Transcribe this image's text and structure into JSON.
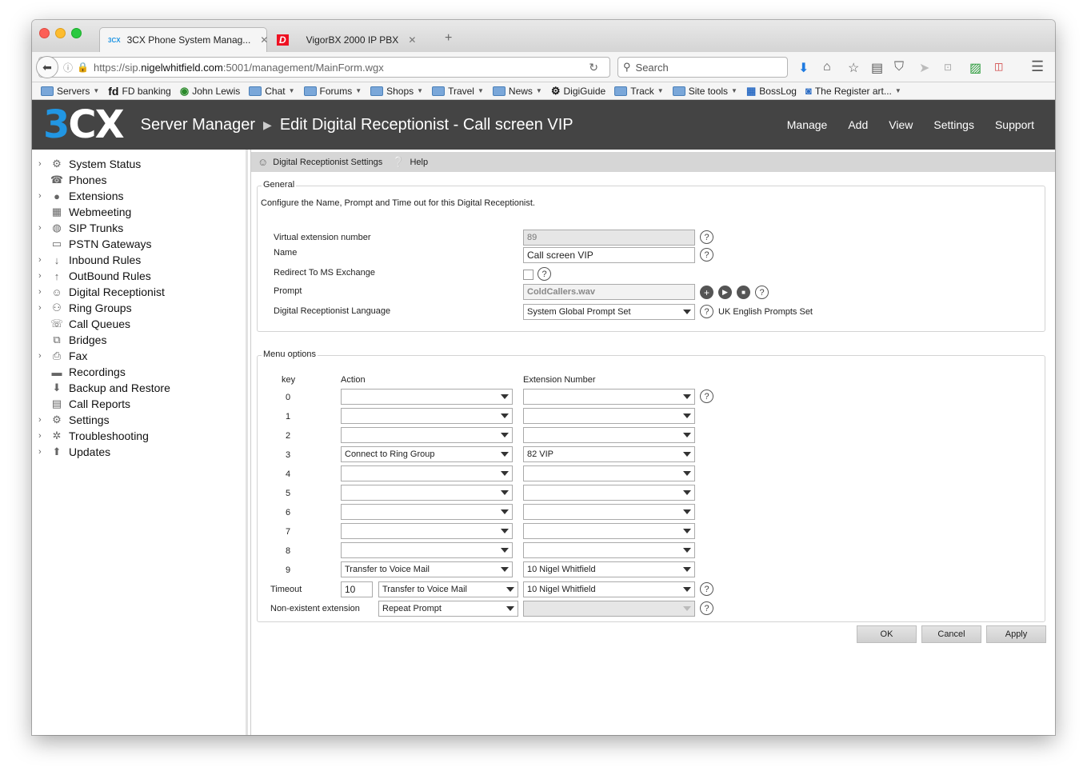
{
  "browser": {
    "tabs": [
      {
        "favicon": "3CX",
        "title": "3CX Phone System Manag...",
        "active": true
      },
      {
        "favicon": "D",
        "title": "VigorBX 2000 IP PBX",
        "active": false
      }
    ],
    "url": {
      "prefix": "https://sip.",
      "domain": "nigelwhitfield.com",
      "suffix": ":5001/management/MainForm.wgx"
    },
    "search_placeholder": "Search",
    "bookmarks": [
      {
        "label": "Servers",
        "icon": "folder-icon",
        "dropdown": true
      },
      {
        "label": "FD banking",
        "icon": "fd-icon",
        "dropdown": false
      },
      {
        "label": "John Lewis",
        "icon": "globe-icon",
        "dropdown": false
      },
      {
        "label": "Chat",
        "icon": "folder-icon",
        "dropdown": true
      },
      {
        "label": "Forums",
        "icon": "folder-icon",
        "dropdown": true
      },
      {
        "label": "Shops",
        "icon": "folder-icon",
        "dropdown": true
      },
      {
        "label": "Travel",
        "icon": "folder-icon",
        "dropdown": true
      },
      {
        "label": "News",
        "icon": "folder-icon",
        "dropdown": true
      },
      {
        "label": "DigiGuide",
        "icon": "gear-icon",
        "dropdown": false
      },
      {
        "label": "Track",
        "icon": "folder-icon",
        "dropdown": true
      },
      {
        "label": "Site tools",
        "icon": "folder-icon",
        "dropdown": true
      },
      {
        "label": "BossLog",
        "icon": "calendar-icon",
        "dropdown": false
      },
      {
        "label": "The Register art...",
        "icon": "rss-icon",
        "dropdown": true
      }
    ]
  },
  "app": {
    "logo_3": "3",
    "logo_cx": "CX",
    "title": "Server Manager",
    "page": "Edit Digital Receptionist - Call screen VIP",
    "menu": [
      "Manage",
      "Add",
      "View",
      "Settings",
      "Support"
    ]
  },
  "sidebar": [
    {
      "label": "System Status",
      "expand": true,
      "icon": "status-icon"
    },
    {
      "label": "Phones",
      "expand": false,
      "icon": "phone-icon"
    },
    {
      "label": "Extensions",
      "expand": true,
      "icon": "user-icon"
    },
    {
      "label": "Webmeeting",
      "expand": false,
      "icon": "webmeeting-icon"
    },
    {
      "label": "SIP Trunks",
      "expand": true,
      "icon": "globe-icon"
    },
    {
      "label": "PSTN Gateways",
      "expand": false,
      "icon": "gateway-icon"
    },
    {
      "label": "Inbound Rules",
      "expand": true,
      "icon": "arrow-down-icon"
    },
    {
      "label": "OutBound Rules",
      "expand": true,
      "icon": "arrow-up-icon"
    },
    {
      "label": "Digital Receptionist",
      "expand": true,
      "icon": "receptionist-icon"
    },
    {
      "label": "Ring Groups",
      "expand": true,
      "icon": "group-icon"
    },
    {
      "label": "Call Queues",
      "expand": false,
      "icon": "queue-icon"
    },
    {
      "label": "Bridges",
      "expand": false,
      "icon": "bridge-icon"
    },
    {
      "label": "Fax",
      "expand": true,
      "icon": "fax-icon"
    },
    {
      "label": "Recordings",
      "expand": false,
      "icon": "folder-icon"
    },
    {
      "label": "Backup and Restore",
      "expand": false,
      "icon": "backup-icon"
    },
    {
      "label": "Call Reports",
      "expand": false,
      "icon": "report-icon"
    },
    {
      "label": "Settings",
      "expand": true,
      "icon": "gear-icon"
    },
    {
      "label": "Troubleshooting",
      "expand": true,
      "icon": "bug-icon"
    },
    {
      "label": "Updates",
      "expand": true,
      "icon": "update-icon"
    }
  ],
  "toolbar": {
    "settings_label": "Digital Receptionist Settings",
    "help_label": "Help"
  },
  "general": {
    "legend": "General",
    "description": "Configure the Name, Prompt and Time out for this Digital Receptionist.",
    "virtual_ext_label": "Virtual extension number",
    "virtual_ext_value": "89",
    "name_label": "Name",
    "name_value": "Call screen VIP",
    "redirect_label": "Redirect To MS Exchange",
    "prompt_label": "Prompt",
    "prompt_value": "ColdCallers.wav",
    "language_label": "Digital Receptionist Language",
    "language_value": "System Global Prompt Set",
    "language_note": "UK English Prompts Set"
  },
  "menu_options": {
    "legend": "Menu options",
    "headers": {
      "key": "key",
      "action": "Action",
      "extension": "Extension Number"
    },
    "rows": [
      {
        "key": "0",
        "action": "",
        "extension": ""
      },
      {
        "key": "1",
        "action": "",
        "extension": ""
      },
      {
        "key": "2",
        "action": "",
        "extension": ""
      },
      {
        "key": "3",
        "action": "Connect to Ring Group",
        "extension": "82 VIP"
      },
      {
        "key": "4",
        "action": "",
        "extension": ""
      },
      {
        "key": "5",
        "action": "",
        "extension": ""
      },
      {
        "key": "6",
        "action": "",
        "extension": ""
      },
      {
        "key": "7",
        "action": "",
        "extension": ""
      },
      {
        "key": "8",
        "action": "",
        "extension": ""
      },
      {
        "key": "9",
        "action": "Transfer to Voice Mail",
        "extension": "10 Nigel Whitfield"
      }
    ],
    "timeout_label": "Timeout",
    "timeout_value": "10",
    "timeout_action": "Transfer to Voice Mail",
    "timeout_extension": "10 Nigel Whitfield",
    "nonexistent_label": "Non-existent extension",
    "nonexistent_action": "Repeat Prompt",
    "nonexistent_extension": ""
  },
  "buttons": {
    "ok": "OK",
    "cancel": "Cancel",
    "apply": "Apply"
  },
  "colors": {
    "header_bg": "#444444",
    "logo_blue": "#2196e3",
    "toolbar_bg": "#d6d6d6"
  }
}
